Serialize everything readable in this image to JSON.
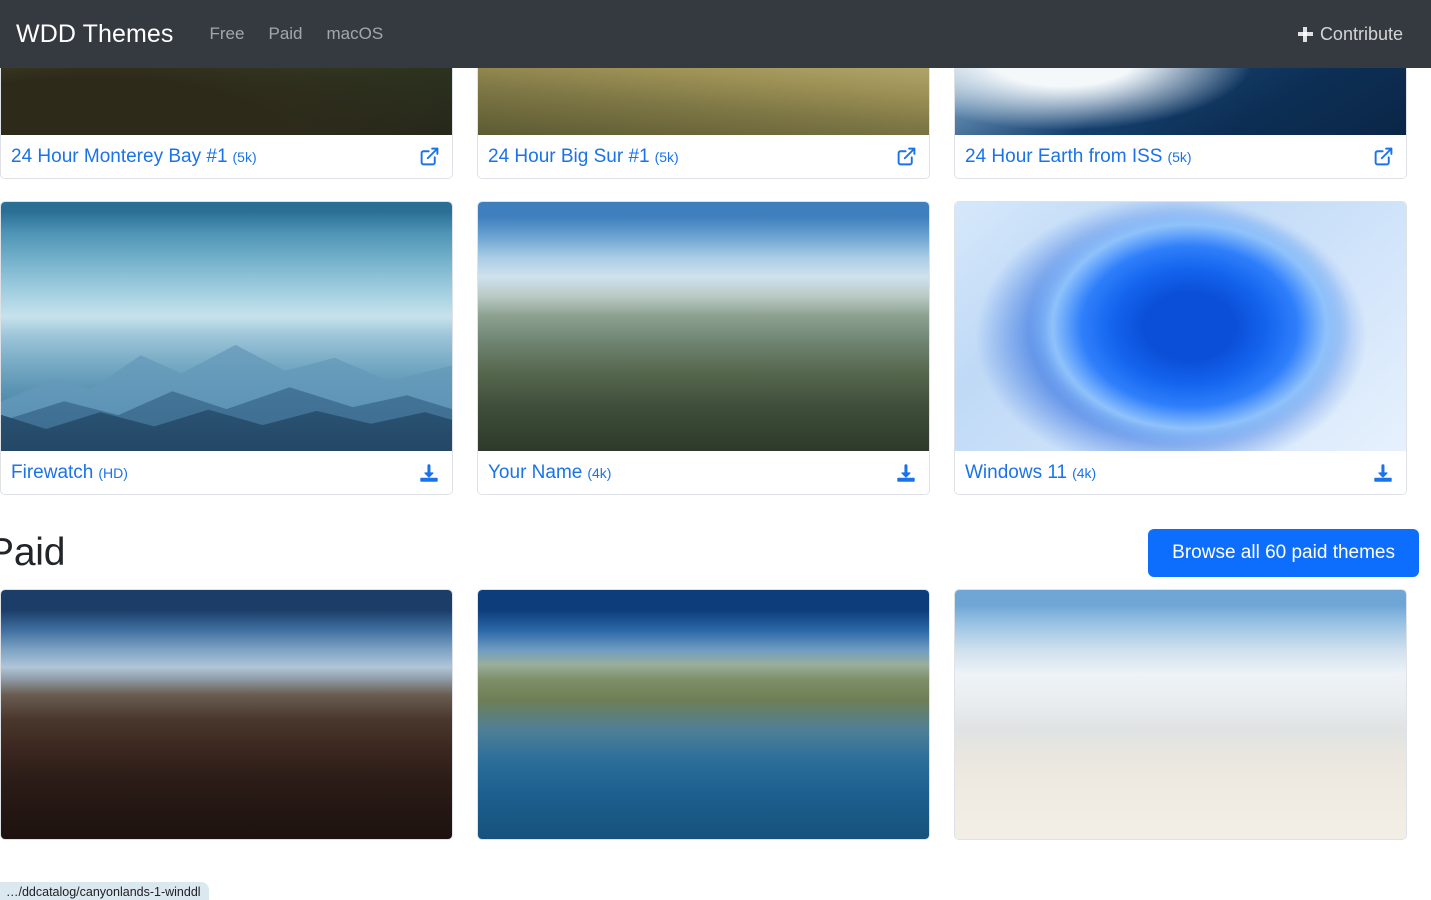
{
  "navbar": {
    "brand": "WDD Themes",
    "links": [
      {
        "label": "Free"
      },
      {
        "label": "Paid"
      },
      {
        "label": "macOS"
      }
    ],
    "contribute": {
      "label": "Contribute",
      "icon": "plus-icon"
    },
    "background_color": "#343a40"
  },
  "theme": {
    "link_color": "#1a73e8",
    "primary_button_color": "#0d6efd"
  },
  "rows": [
    {
      "id": "free-row-1",
      "cards": [
        {
          "title": "24 Hour Monterey Bay #1",
          "resolution": "(5k)",
          "action": "external-link-icon",
          "art": "art-monterey"
        },
        {
          "title": "24 Hour Big Sur #1",
          "resolution": "(5k)",
          "action": "external-link-icon",
          "art": "art-bigsur"
        },
        {
          "title": "24 Hour Earth from ISS",
          "resolution": "(5k)",
          "action": "external-link-icon",
          "art": "art-iss"
        }
      ]
    },
    {
      "id": "free-row-2",
      "cards": [
        {
          "title": "Firewatch",
          "resolution": "(HD)",
          "action": "download-icon",
          "art": "art-firewatch"
        },
        {
          "title": "Your Name",
          "resolution": "(4k)",
          "action": "download-icon",
          "art": "art-yourname"
        },
        {
          "title": "Windows 11",
          "resolution": "(4k)",
          "action": "download-icon",
          "art": "art-win11"
        }
      ]
    },
    {
      "id": "paid-row-1",
      "cards": [
        {
          "title": "",
          "resolution": "",
          "action": "",
          "art": "art-canyon"
        },
        {
          "title": "",
          "resolution": "",
          "action": "",
          "art": "art-coast"
        },
        {
          "title": "",
          "resolution": "",
          "action": "",
          "art": "art-sands"
        }
      ]
    }
  ],
  "paid_section": {
    "title": "Paid",
    "browse_button": "Browse all 60 paid themes"
  },
  "status_bar": {
    "url": "…/ddcatalog/canyonlands-1-winddl"
  }
}
